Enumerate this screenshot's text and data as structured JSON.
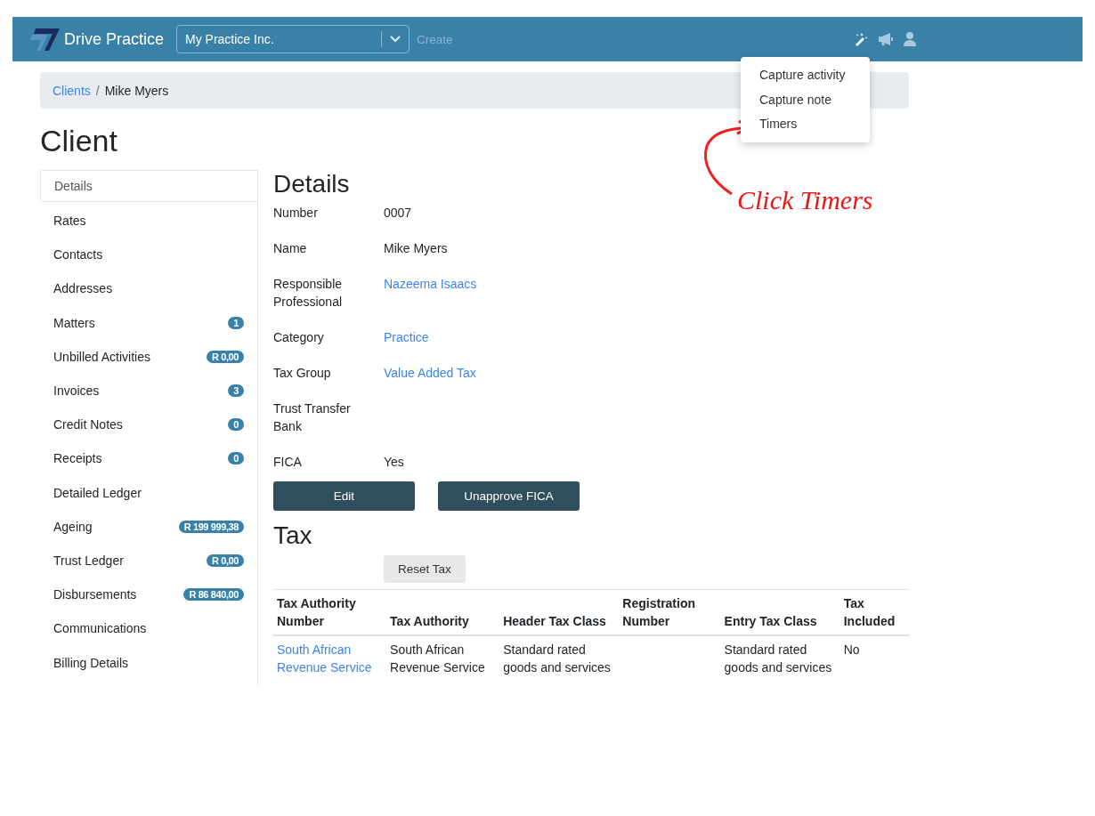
{
  "navbar": {
    "brand": "Drive Practice",
    "practice_select": {
      "value": "My Practice Inc."
    },
    "create_link": "Create"
  },
  "action_menu": {
    "items": [
      "Capture activity",
      "Capture note",
      "Timers"
    ]
  },
  "annotation": {
    "text": "Click Timers"
  },
  "breadcrumb": [
    {
      "label": "Clients",
      "kind": "link"
    },
    {
      "label": "/",
      "kind": "separator"
    },
    {
      "label": "Mike Myers",
      "kind": "current"
    }
  ],
  "page_title": "Client",
  "sidebar": {
    "items": [
      {
        "label": "Details",
        "selected": true
      },
      {
        "label": "Rates",
        "selected": false
      },
      {
        "label": "Contacts",
        "selected": false
      },
      {
        "label": "Addresses",
        "selected": false
      },
      {
        "label": "Matters",
        "selected": false,
        "badge": "1"
      },
      {
        "label": "Unbilled Activities",
        "selected": false,
        "badge": "R 0,00"
      },
      {
        "label": "Invoices",
        "selected": false,
        "badge": "3"
      },
      {
        "label": "Credit Notes",
        "selected": false,
        "badge": "0"
      },
      {
        "label": "Receipts",
        "selected": false,
        "badge": "0"
      },
      {
        "label": "Detailed Ledger",
        "selected": false
      },
      {
        "label": "Ageing",
        "selected": false,
        "badge": "R 199 999,38"
      },
      {
        "label": "Trust Ledger",
        "selected": false,
        "badge": "R 0,00"
      },
      {
        "label": "Disbursements",
        "selected": false,
        "badge": "R 86 840,00"
      },
      {
        "label": "Communications",
        "selected": false
      },
      {
        "label": "Billing Details",
        "selected": false
      }
    ]
  },
  "details": {
    "heading": "Details",
    "fields": [
      {
        "label": "Number",
        "value": "0007",
        "kind": "text"
      },
      {
        "label": "Name",
        "value": "Mike Myers",
        "kind": "text"
      },
      {
        "label": "Responsible Professional",
        "value": "Nazeema Isaacs",
        "kind": "link"
      },
      {
        "label": "Category",
        "value": "Practice",
        "kind": "link"
      },
      {
        "label": "Tax Group",
        "value": "Value Added Tax",
        "kind": "link"
      },
      {
        "label": "Trust Transfer Bank"
      },
      {
        "label": "FICA",
        "value": "Yes",
        "kind": "text"
      }
    ],
    "buttons": [
      "Edit",
      "Unapprove FICA"
    ]
  },
  "tax": {
    "heading": "Tax",
    "reset_button": "Reset Tax",
    "table": {
      "columns": [
        "Tax Authority Number",
        "Tax Authority",
        "Header Tax Class",
        "Registration Number",
        "Entry Tax Class",
        "Tax Included"
      ],
      "rows": [
        [
          {
            "text": "South African Revenue Service",
            "kind": "link"
          },
          {
            "text": "South African Revenue Service",
            "kind": "text"
          },
          {
            "text": "Standard rated goods and services",
            "kind": "text"
          },
          {},
          {
            "text": "Standard rated goods and services",
            "kind": "text"
          },
          {
            "text": "No",
            "kind": "text"
          }
        ]
      ]
    }
  }
}
